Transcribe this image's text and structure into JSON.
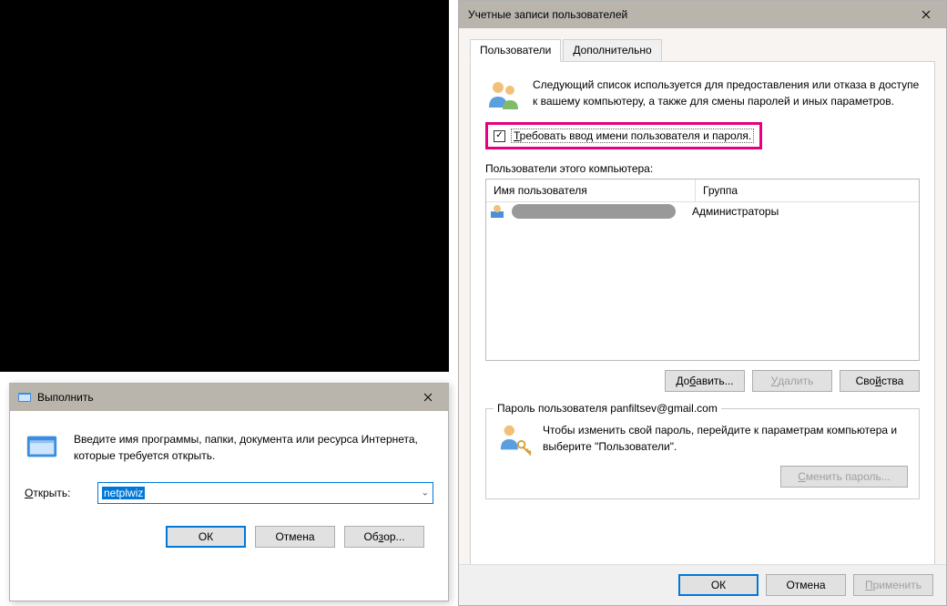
{
  "run_dialog": {
    "title": "Выполнить",
    "instruction": "Введите имя программы, папки, документа или ресурса Интернета, которые требуется открыть.",
    "open_label": "Открыть:",
    "input_value": "netplwiz",
    "buttons": {
      "ok": "ОК",
      "cancel": "Отмена",
      "browse": "Обзор..."
    }
  },
  "user_accounts": {
    "title": "Учетные записи пользователей",
    "tabs": {
      "users": "Пользователи",
      "advanced": "Дополнительно"
    },
    "intro": "Следующий список используется для предоставления или отказа в доступе к вашему компьютеру, а также для смены паролей и иных параметров.",
    "require_checkbox_label": "Требовать ввод имени пользователя и пароля.",
    "require_checkbox_checked": true,
    "list_label": "Пользователи этого компьютера:",
    "columns": {
      "name": "Имя пользователя",
      "group": "Группа"
    },
    "rows": [
      {
        "name_redacted": true,
        "group": "Администраторы"
      }
    ],
    "list_buttons": {
      "add": "Добавить...",
      "remove": "Удалить",
      "properties": "Свойства"
    },
    "password_section": {
      "legend": "Пароль пользователя panfiltsev@gmail.com",
      "text": "Чтобы изменить свой пароль, перейдите к параметрам компьютера и выберите \"Пользователи\".",
      "change_button": "Сменить пароль..."
    },
    "bottom_buttons": {
      "ok": "ОК",
      "cancel": "Отмена",
      "apply": "Применить"
    }
  }
}
